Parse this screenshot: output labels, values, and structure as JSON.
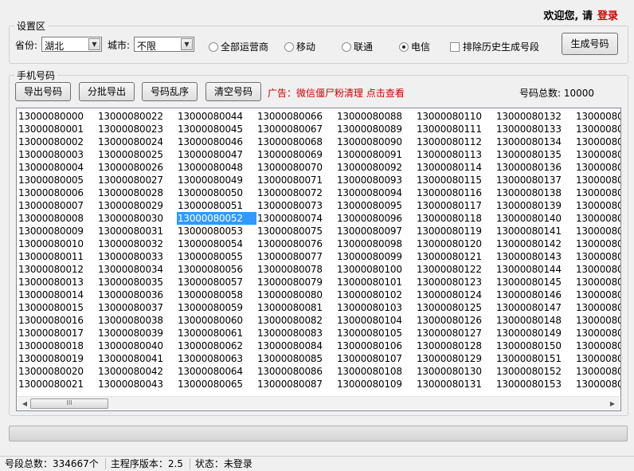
{
  "header": {
    "welcome": "欢迎您, 请",
    "login": "登录"
  },
  "settings": {
    "legend": "设置区",
    "province_label": "省份:",
    "province_value": "湖北",
    "city_label": "城市:",
    "city_value": "不限",
    "carriers": [
      {
        "label": "全部运营商",
        "selected": false
      },
      {
        "label": "移动",
        "selected": false
      },
      {
        "label": "联通",
        "selected": false
      },
      {
        "label": "电信",
        "selected": true
      }
    ],
    "exclude_history": "排除历史生成号段",
    "generate_button": "生成号码"
  },
  "phones": {
    "legend": "手机号码",
    "buttons": {
      "export": "导出号码",
      "batch_export": "分批导出",
      "shuffle": "号码乱序",
      "clear": "清空号码"
    },
    "ad": "广告：微信僵尸粉清理 点击查看",
    "total_label": "号码总数:",
    "total_value": "10000",
    "first_number": 13000080000,
    "rows": 22,
    "visible_columns": 8,
    "selected_number": "13000080052"
  },
  "progress": {
    "value": 0
  },
  "status": {
    "segment_total": "号段总数：334667个",
    "version": "主程序版本：2.5",
    "state": "状态：未登录"
  },
  "colors": {
    "login": "#d00000",
    "ad": "#cc0000",
    "selection": "#3399ff"
  }
}
